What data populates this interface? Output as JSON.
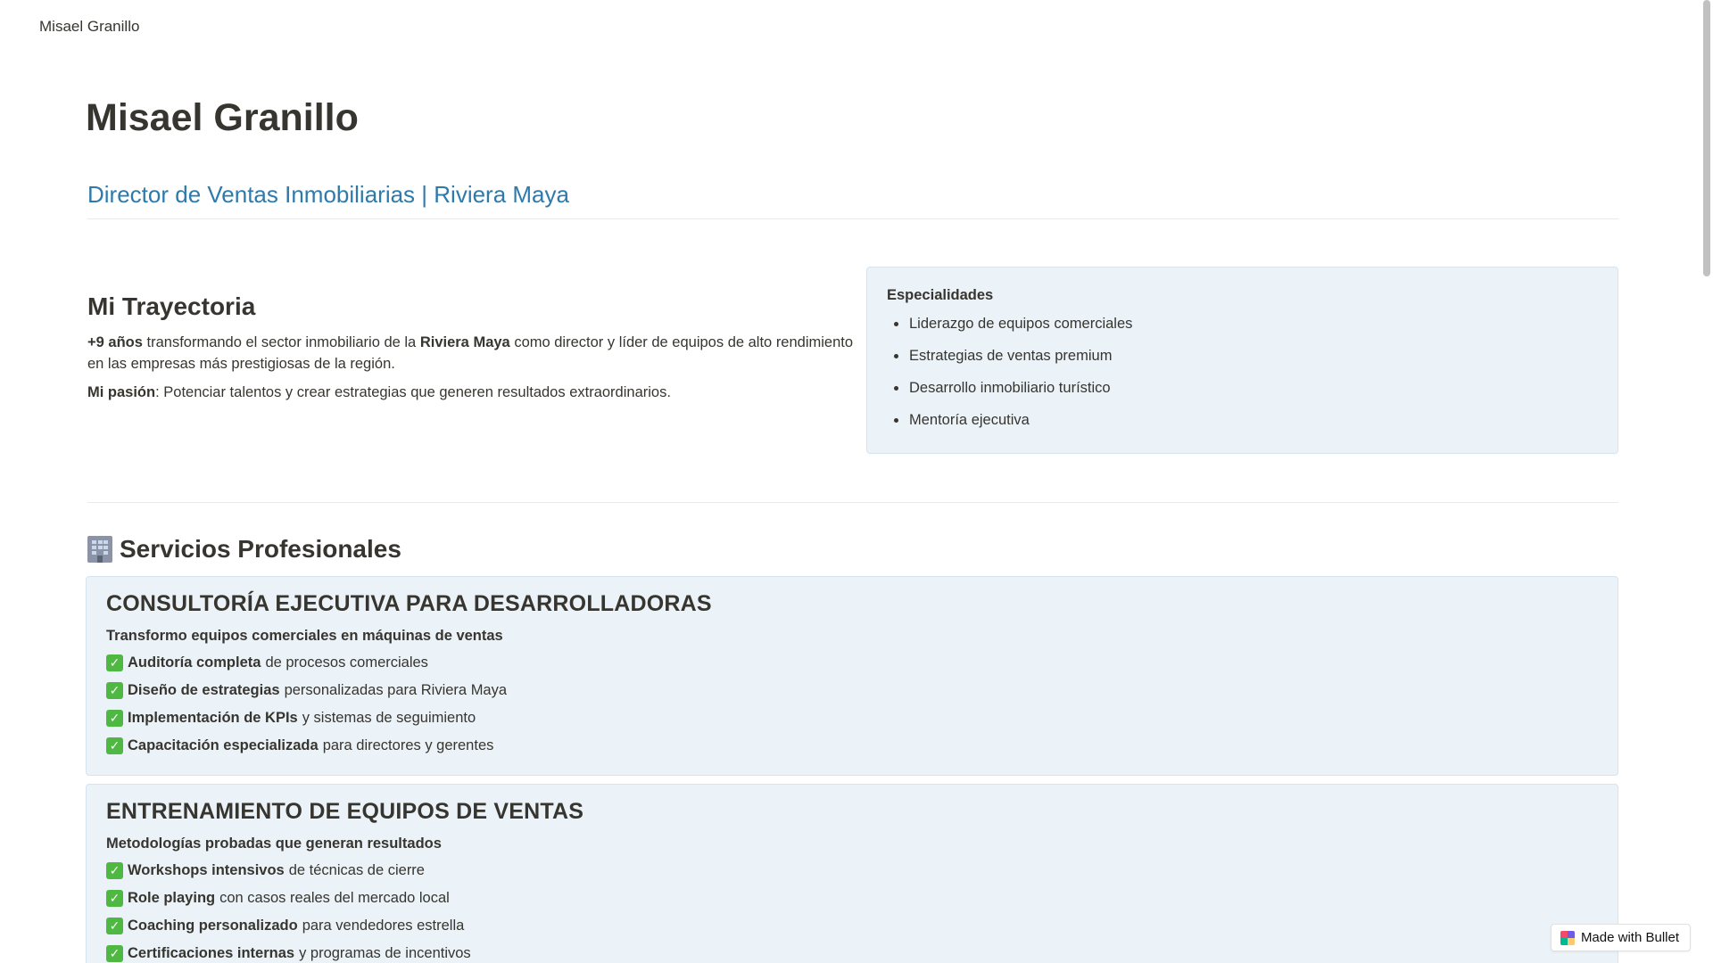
{
  "site": {
    "name": "Misael Granillo"
  },
  "header": {
    "title": "Misael Granillo",
    "subtitle": "Director de Ventas Inmobiliarias | Riviera Maya"
  },
  "trayectoria": {
    "heading": "Mi Trayectoria",
    "p1_bold1": "+9 años",
    "p1_text1": " transformando el sector inmobiliario de la ",
    "p1_bold2": "Riviera Maya",
    "p1_text2": " como director y líder de equipos de alto rendimiento en las empresas más prestigiosas de la región.",
    "p2_bold": "Mi pasión",
    "p2_text": ": Potenciar talentos y crear estrategias que generen resultados extraordinarios."
  },
  "especialidades": {
    "title": "Especialidades",
    "items": [
      "Liderazgo de equipos comerciales",
      "Estrategias de ventas premium",
      "Desarrollo inmobiliario turístico",
      "Mentoría ejecutiva"
    ]
  },
  "servicios": {
    "heading": "Servicios Profesionales",
    "icon": "building-icon",
    "cards": [
      {
        "title": "CONSULTORÍA EJECUTIVA PARA DESARROLLADORAS",
        "lead": "Transformo equipos comerciales en máquinas de ventas",
        "items": [
          {
            "bold": "Auditoría completa",
            "text": "de procesos comerciales"
          },
          {
            "bold": "Diseño de estrategias",
            "text": "personalizadas para Riviera Maya"
          },
          {
            "bold": "Implementación de KPIs",
            "text": "y sistemas de seguimiento"
          },
          {
            "bold": "Capacitación especializada",
            "text": "para directores y gerentes"
          }
        ]
      },
      {
        "title": "ENTRENAMIENTO DE EQUIPOS DE VENTAS",
        "lead": "Metodologías probadas que generan resultados",
        "items": [
          {
            "bold": "Workshops intensivos",
            "text": "de técnicas de cierre"
          },
          {
            "bold": "Role playing",
            "text": "con casos reales del mercado local"
          },
          {
            "bold": "Coaching personalizado",
            "text": "para vendedores estrella"
          },
          {
            "bold": "Certificaciones internas",
            "text": "y programas de incentivos"
          }
        ]
      }
    ]
  },
  "footer": {
    "made_with": "Made with Bullet"
  },
  "colors": {
    "accent": "#2e7aab",
    "card_bg": "#ebf2f8",
    "check": "#4fb843"
  }
}
